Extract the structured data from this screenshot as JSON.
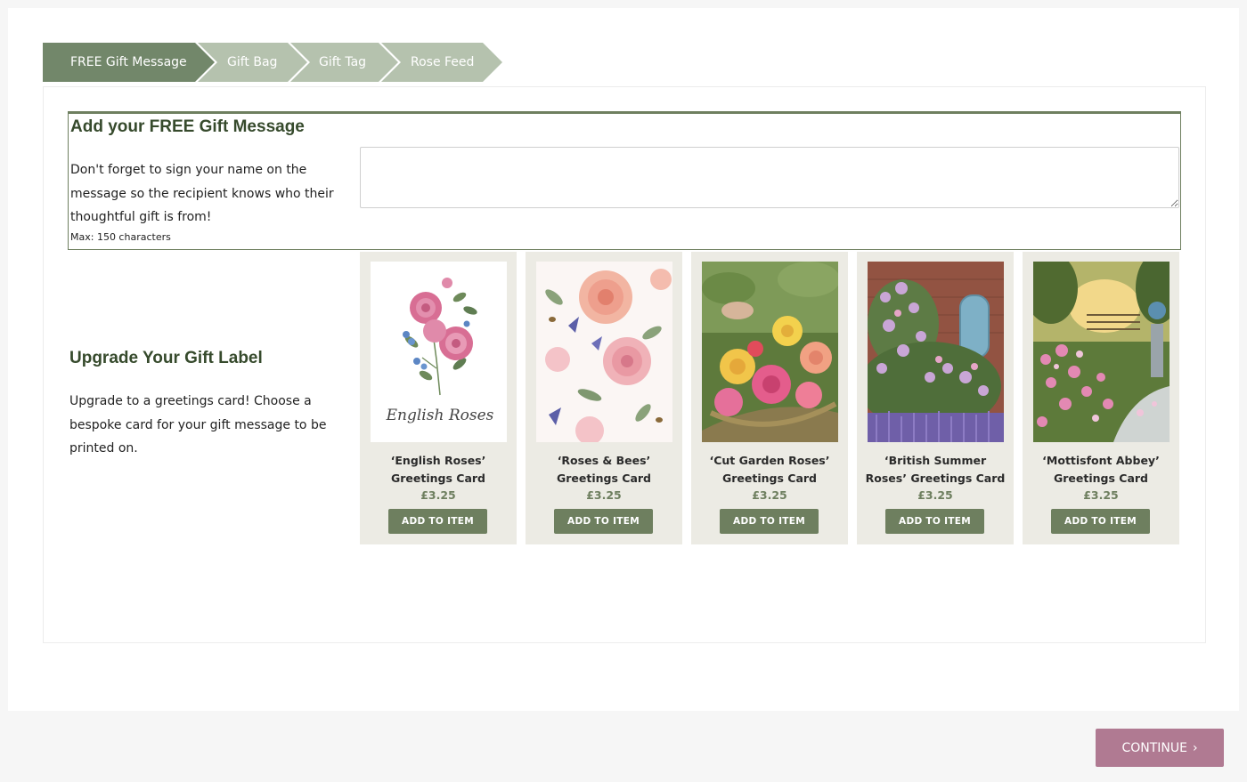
{
  "steps": [
    {
      "label": "FREE Gift Message",
      "active": true
    },
    {
      "label": "Gift Bag",
      "active": false
    },
    {
      "label": "Gift Tag",
      "active": false
    },
    {
      "label": "Rose Feed",
      "active": false
    }
  ],
  "message": {
    "title": "Add your FREE Gift Message",
    "description": "Don't forget to sign your name on the message so the recipient knows who their thoughtful gift is from!",
    "max_note": "Max: 150 characters",
    "value": ""
  },
  "upgrade": {
    "title": "Upgrade Your Gift Label",
    "description": "Upgrade to a greetings card! Choose a bespoke card for your gift message to be printed on."
  },
  "cards": [
    {
      "title": "‘English Roses’ Greetings Card",
      "price": "£3.25",
      "button": "ADD TO ITEM",
      "image_text": "English Roses"
    },
    {
      "title": "‘Roses & Bees’ Greetings Card",
      "price": "£3.25",
      "button": "ADD TO ITEM"
    },
    {
      "title": "‘Cut Garden Roses’ Greetings Card",
      "price": "£3.25",
      "button": "ADD TO ITEM"
    },
    {
      "title": "‘British Summer Roses’ Greetings Card",
      "price": "£3.25",
      "button": "ADD TO ITEM"
    },
    {
      "title": "‘Mottisfont Abbey’ Greetings Card",
      "price": "£3.25",
      "button": "ADD TO ITEM"
    }
  ],
  "continue": {
    "label": "CONTINUE"
  },
  "colors": {
    "accent_green": "#72876a",
    "inactive_green": "#b5c2ae",
    "heading_green": "#364a2c",
    "card_bg": "#ecebe4",
    "continue_pink": "#b07a92"
  }
}
